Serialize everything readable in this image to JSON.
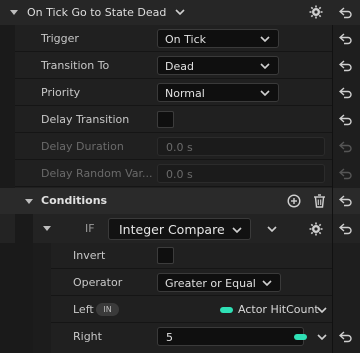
{
  "header": {
    "title": "On Tick Go to State Dead"
  },
  "properties": {
    "trigger": {
      "label": "Trigger",
      "value": "On Tick"
    },
    "transition_to": {
      "label": "Transition To",
      "value": "Dead"
    },
    "priority": {
      "label": "Priority",
      "value": "Normal"
    },
    "delay_transition": {
      "label": "Delay Transition",
      "checked": false
    },
    "delay_duration": {
      "label": "Delay Duration",
      "value": "0.0 s"
    },
    "delay_random": {
      "label": "Delay Random Var...",
      "value": "0.0 s"
    }
  },
  "conditions": {
    "title": "Conditions",
    "if_label": "IF",
    "condition_type": "Integer Compare",
    "invert": {
      "label": "Invert",
      "checked": false
    },
    "operator": {
      "label": "Operator",
      "value": "Greater or Equal"
    },
    "left": {
      "label": "Left",
      "badge": "IN",
      "value": "Actor HitCount"
    },
    "right": {
      "label": "Right",
      "value": "5"
    }
  },
  "colors": {
    "pin": "#2fe0b5",
    "background": "#202020",
    "header": "#262626"
  },
  "icons": [
    "caret-down-icon",
    "chevron-down-icon",
    "settings-gear-icon",
    "reset-arrow-icon",
    "add-circle-icon",
    "trash-icon"
  ]
}
